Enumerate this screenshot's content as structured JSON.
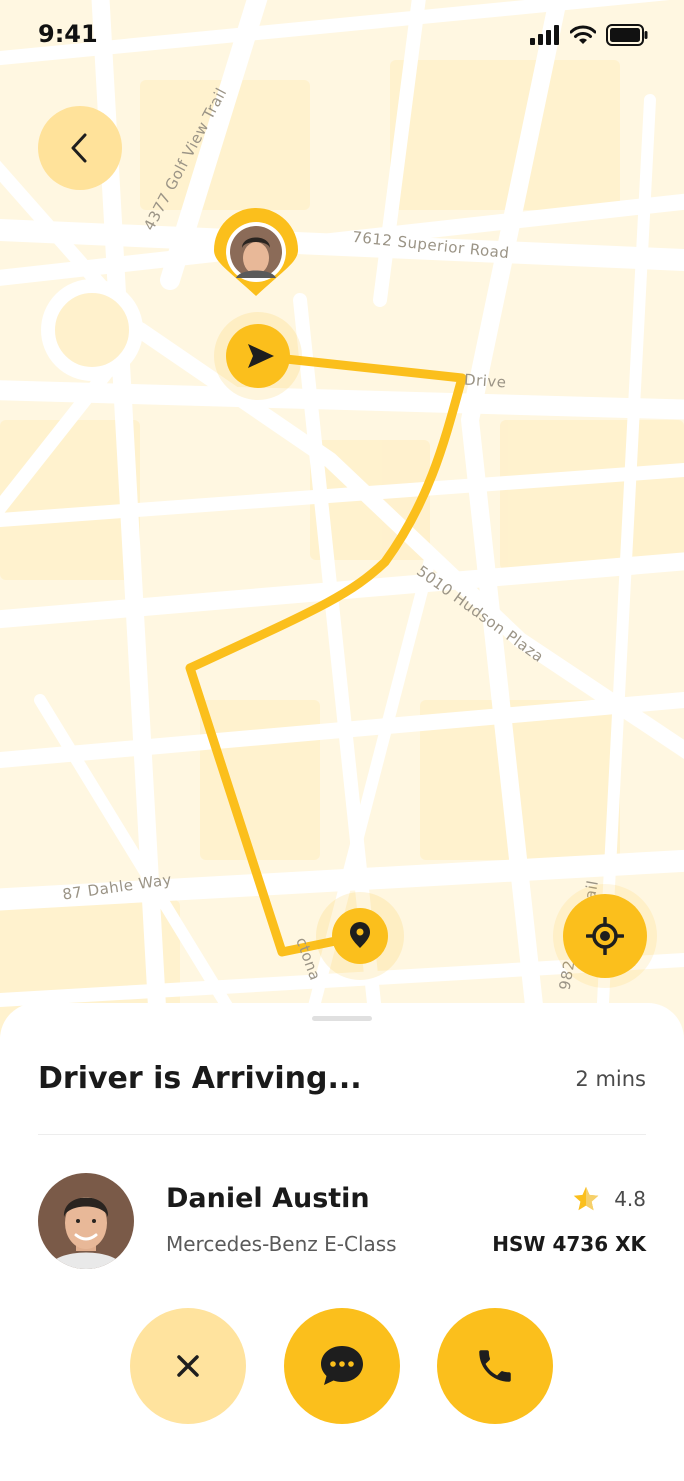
{
  "status_bar": {
    "time": "9:41"
  },
  "map": {
    "road_labels": [
      "4377 Golf View Trail",
      "7612 Superior Road",
      "Drive",
      "5010 Hudson Plaza",
      "87 Dahle Way",
      "ctona",
      "982",
      "rail"
    ],
    "colors": {
      "route": "#FBBF1C",
      "background": "#FFF7E1",
      "roads": "#FFFFFF"
    }
  },
  "trip": {
    "title": "Driver is Arriving...",
    "eta": "2 mins"
  },
  "driver": {
    "name": "Daniel Austin",
    "car": "Mercedes-Benz E-Class",
    "rating": "4.8",
    "plate": "HSW 4736 XK"
  },
  "icons": {
    "back": "chevron-left-icon",
    "locate": "crosshair-icon",
    "cancel": "close-icon",
    "chat": "chat-bubble-icon",
    "call": "phone-icon",
    "rating": "star-icon"
  },
  "colors": {
    "accent": "#FBBF1C",
    "accent_light": "#FFE39E"
  }
}
